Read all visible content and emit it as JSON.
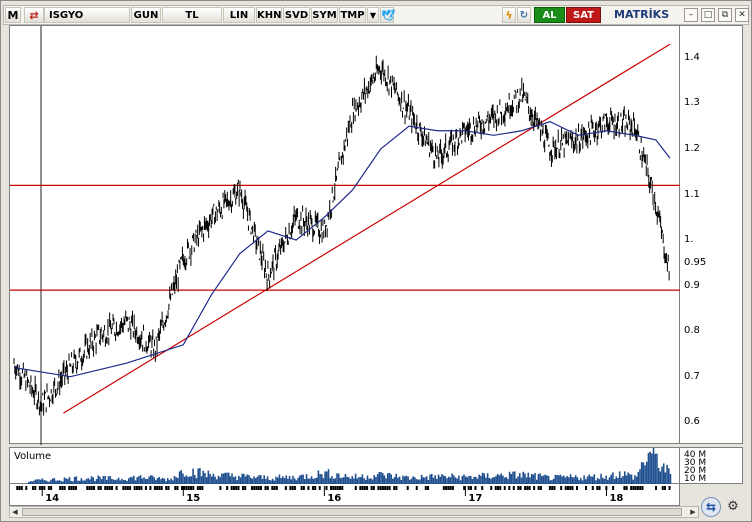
{
  "toolbar": {
    "m_label": "M",
    "symbol": "ISGYO",
    "period": "GUN",
    "currency": "TL",
    "scale": "LIN",
    "buttons": [
      "KHN",
      "SVD",
      "SYM",
      "TMP"
    ],
    "buy_label": "AL",
    "sell_label": "SAT",
    "brand": "MATRİKS",
    "colors": {
      "buy": "#1a8c1a",
      "sell": "#c01818",
      "twitter": "#1da1f2",
      "lightning": "#e08b00"
    }
  },
  "volume_label": "Volume",
  "volume_ticks": [
    "40 M",
    "30 M",
    "20 M",
    "10 M"
  ],
  "chart_data": {
    "type": "line",
    "instrument": "ISGYO",
    "x_tick_labels": [
      "14",
      "15",
      "16",
      "17",
      "18"
    ],
    "y_ticks": [
      "1.4",
      "1.3",
      "1.2",
      "1.1",
      "1.",
      "0.95",
      "0.9",
      "0.8",
      "0.7",
      "0.6"
    ],
    "ylim": [
      0.55,
      1.47
    ],
    "grid": false,
    "series": [
      {
        "style": "bar",
        "color": "#000000",
        "x": [
          13.8,
          14.0,
          14.2,
          14.4,
          14.6,
          14.8,
          15.0,
          15.2,
          15.4,
          15.6,
          15.8,
          16.0,
          16.2,
          16.4,
          16.6,
          16.8,
          17.0,
          17.2,
          17.4,
          17.6,
          17.8,
          18.0,
          18.2,
          18.35,
          18.45
        ],
        "y": [
          0.73,
          0.64,
          0.72,
          0.79,
          0.82,
          0.76,
          0.96,
          1.05,
          1.11,
          0.92,
          1.05,
          1.02,
          1.28,
          1.38,
          1.28,
          1.18,
          1.24,
          1.27,
          1.32,
          1.2,
          1.22,
          1.26,
          1.25,
          1.08,
          0.92
        ]
      },
      {
        "style": "moving-average",
        "color": "#1f2a8a",
        "x": [
          13.8,
          14.2,
          14.6,
          15.0,
          15.2,
          15.4,
          15.6,
          15.8,
          16.0,
          16.2,
          16.4,
          16.6,
          16.8,
          17.0,
          17.2,
          17.4,
          17.6,
          17.8,
          18.0,
          18.2,
          18.35,
          18.45
        ],
        "y": [
          0.72,
          0.7,
          0.73,
          0.77,
          0.88,
          0.97,
          1.02,
          1.0,
          1.05,
          1.11,
          1.2,
          1.25,
          1.24,
          1.24,
          1.23,
          1.24,
          1.26,
          1.23,
          1.24,
          1.23,
          1.22,
          1.18
        ]
      }
    ],
    "trendlines": [
      {
        "x": [
          14.15,
          18.45
        ],
        "y": [
          0.62,
          1.43
        ],
        "color": "#cc0000"
      }
    ],
    "horizontal_lines": [
      {
        "y": 1.12,
        "color": "#cc0000"
      },
      {
        "y": 0.89,
        "color": "#cc0000"
      }
    ],
    "volume": {
      "x": [
        13.9,
        14.1,
        14.3,
        14.5,
        14.7,
        14.9,
        15.0,
        15.2,
        15.4,
        15.6,
        15.8,
        16.0,
        16.2,
        16.4,
        16.6,
        16.8,
        17.0,
        17.2,
        17.4,
        17.6,
        17.8,
        18.0,
        18.1,
        18.2,
        18.3,
        18.45
      ],
      "values": [
        4,
        6,
        8,
        7,
        9,
        6,
        18,
        12,
        10,
        8,
        9,
        14,
        9,
        12,
        8,
        10,
        9,
        11,
        12,
        8,
        9,
        10,
        14,
        9,
        42,
        12
      ]
    }
  }
}
